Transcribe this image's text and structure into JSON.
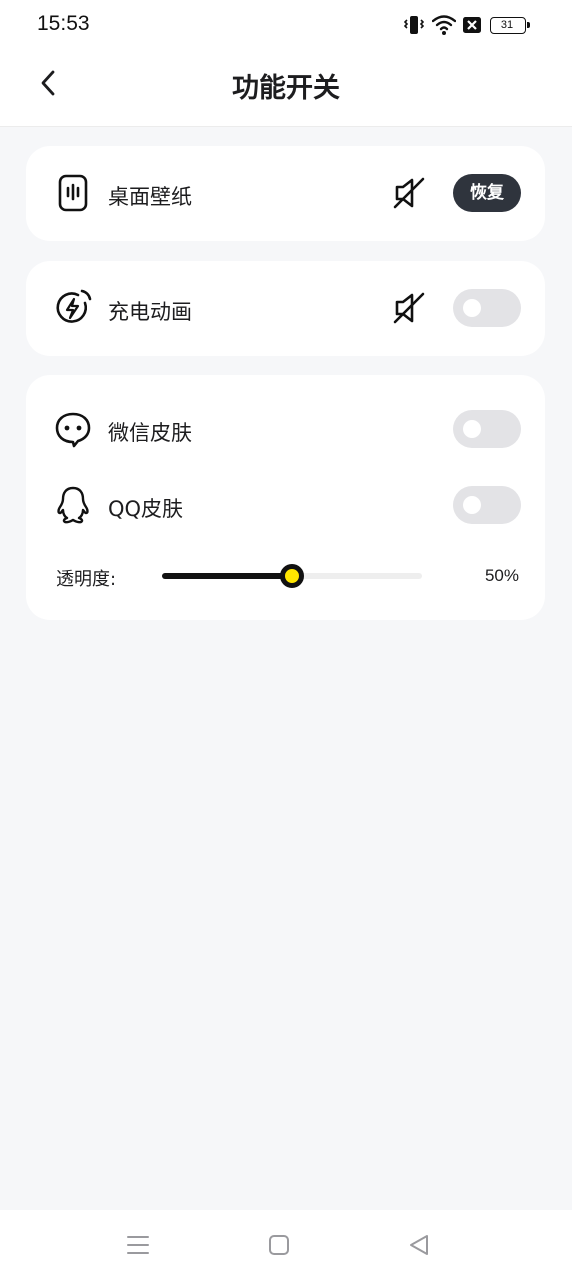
{
  "status": {
    "time": "15:53",
    "battery_level": "31",
    "icons": [
      "vibrate-icon",
      "wifi-icon",
      "sim-no-signal-icon",
      "battery-icon"
    ]
  },
  "header": {
    "title": "功能开关",
    "back_icon": "chevron-left-icon"
  },
  "wallpaper": {
    "icon": "phone-wallpaper-icon",
    "label": "桌面壁纸",
    "status_icon": "muted-icon",
    "button_label": "恢复"
  },
  "charging": {
    "icon": "charging-bolt-icon",
    "label": "充电动画",
    "status_icon": "muted-icon",
    "enabled": false
  },
  "skins": {
    "wechat": {
      "icon": "wechat-chat-icon",
      "label": "微信皮肤",
      "enabled": false
    },
    "qq": {
      "icon": "qq-penguin-icon",
      "label": "QQ皮肤",
      "enabled": false
    },
    "opacity": {
      "label": "透明度:",
      "value_text": "50%",
      "value": 0.5
    }
  },
  "navbar": {
    "icons": [
      "menu-icon",
      "home-square-icon",
      "back-triangle-icon"
    ]
  },
  "colors": {
    "accent": "#ffe600",
    "dark": "#111111",
    "button_bg": "#2f343d",
    "toggle_off": "#e3e3e6",
    "page_bg": "#f6f7f9"
  }
}
